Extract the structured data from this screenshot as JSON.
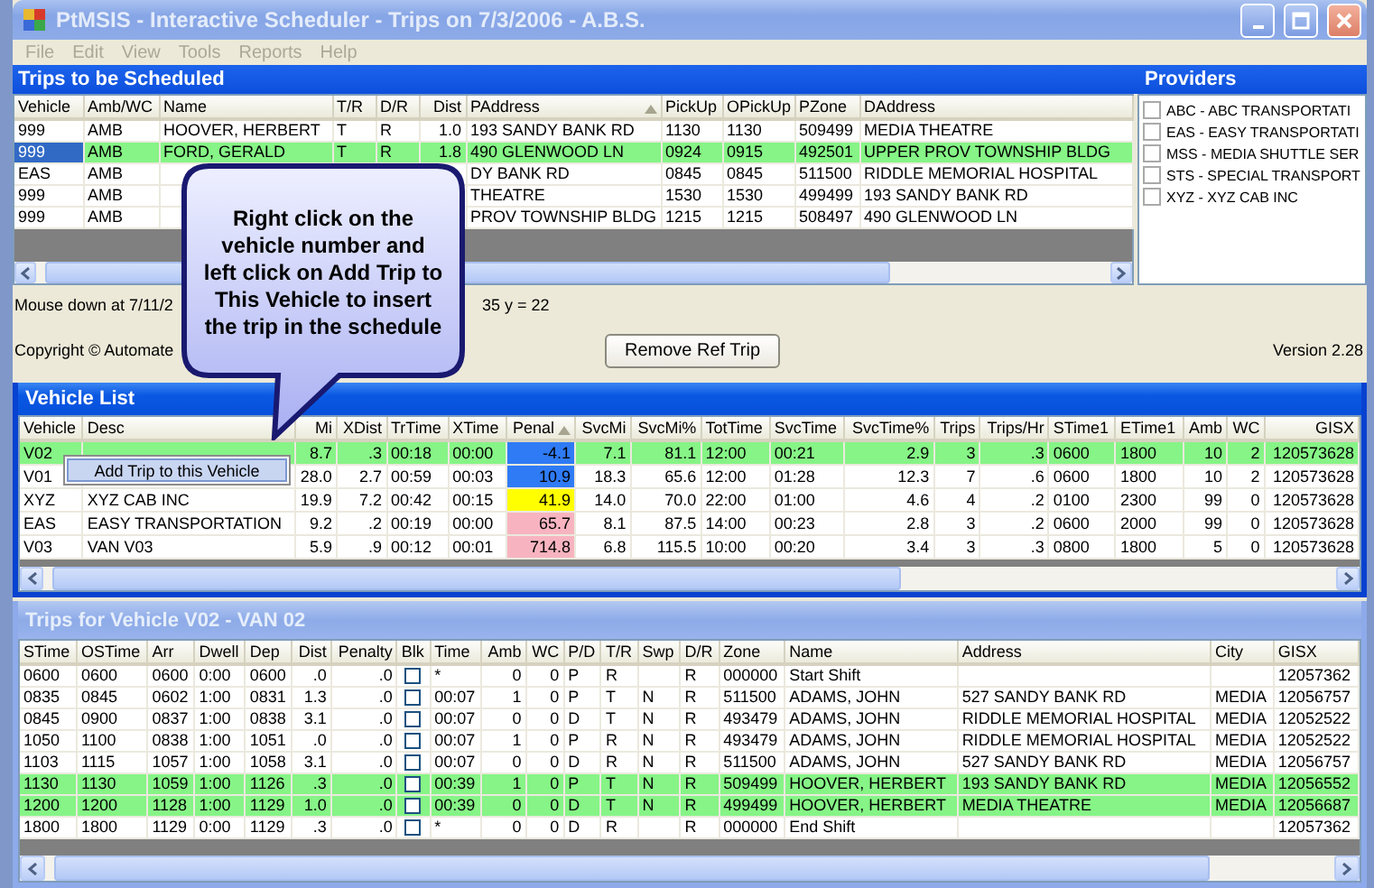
{
  "window": {
    "title": "PtMSIS - Interactive Scheduler - Trips on 7/3/2006 - A.B.S.",
    "active": false
  },
  "menu": [
    {
      "label": "File",
      "disabled": true
    },
    {
      "label": "Edit",
      "disabled": true
    },
    {
      "label": "View",
      "disabled": true
    },
    {
      "label": "Tools",
      "disabled": true
    },
    {
      "label": "Reports",
      "disabled": true
    },
    {
      "label": "Help",
      "disabled": true
    }
  ],
  "trips_to_schedule": {
    "title": "Trips to be Scheduled",
    "columns": [
      {
        "label": "Vehicle",
        "kind": "text",
        "sorted": false
      },
      {
        "label": "Amb/WC",
        "kind": "text",
        "sorted": false
      },
      {
        "label": "Name",
        "kind": "text",
        "sorted": false
      },
      {
        "label": "T/R",
        "kind": "text",
        "sorted": false
      },
      {
        "label": "D/R",
        "kind": "text",
        "sorted": false
      },
      {
        "label": "Dist",
        "kind": "num",
        "sorted": false
      },
      {
        "label": "PAddress",
        "kind": "text",
        "sorted": true
      },
      {
        "label": "PickUp",
        "kind": "text",
        "sorted": false
      },
      {
        "label": "OPickUp",
        "kind": "text",
        "sorted": false
      },
      {
        "label": "PZone",
        "kind": "text",
        "sorted": false
      },
      {
        "label": "DAddress",
        "kind": "text",
        "sorted": false
      }
    ],
    "rows": [
      {
        "selected": false,
        "focused": false,
        "cells": [
          "999",
          "AMB",
          "HOOVER, HERBERT",
          "T",
          "R",
          "1.0",
          "193 SANDY BANK RD",
          "1130",
          "1130",
          "509499",
          "MEDIA THEATRE"
        ]
      },
      {
        "selected": true,
        "focused": true,
        "cells": [
          "999",
          "AMB",
          "FORD, GERALD",
          "T",
          "R",
          "1.8",
          "490 GLENWOOD LN",
          "0924",
          "0915",
          "492501",
          "UPPER PROV TOWNSHIP BLDG"
        ]
      },
      {
        "selected": false,
        "focused": false,
        "cells": [
          "EAS",
          "AMB",
          null,
          null,
          null,
          null,
          "DY BANK RD",
          "0845",
          "0845",
          "511500",
          "RIDDLE MEMORIAL HOSPITAL"
        ]
      },
      {
        "selected": false,
        "focused": false,
        "cells": [
          "999",
          "AMB",
          null,
          null,
          null,
          null,
          "THEATRE",
          "1530",
          "1530",
          "499499",
          "193 SANDY BANK RD"
        ]
      },
      {
        "selected": false,
        "focused": false,
        "cells": [
          "999",
          "AMB",
          null,
          null,
          null,
          null,
          "PROV TOWNSHIP BLDG",
          "1215",
          "1215",
          "508497",
          "490 GLENWOOD LN"
        ]
      }
    ]
  },
  "providers": {
    "title": "Providers",
    "items": [
      {
        "label": "ABC - ABC TRANSPORTATI",
        "checked": false
      },
      {
        "label": "EAS - EASY TRANSPORTATI",
        "checked": false
      },
      {
        "label": "MSS - MEDIA SHUTTLE SER",
        "checked": false
      },
      {
        "label": "STS - SPECIAL TRANSPORT",
        "checked": false
      },
      {
        "label": "XYZ - XYZ CAB INC",
        "checked": false
      }
    ]
  },
  "status": {
    "mouse_text": "Mouse down at 7/11/2",
    "mouse_coords": "35 y = 22",
    "copyright": "Copyright © Automate",
    "button": "Remove Ref Trip",
    "version": "Version 2.28"
  },
  "vehicle_list": {
    "title": "Vehicle List",
    "active": true,
    "columns": [
      {
        "label": "Vehicle",
        "kind": "text",
        "sorted": false
      },
      {
        "label": "Desc",
        "kind": "text",
        "sorted": false
      },
      {
        "label": "Mi",
        "kind": "num",
        "sorted": false
      },
      {
        "label": "XDist",
        "kind": "num",
        "sorted": false
      },
      {
        "label": "TrTime",
        "kind": "text",
        "sorted": false
      },
      {
        "label": "XTime",
        "kind": "text",
        "sorted": false
      },
      {
        "label": "Penal",
        "kind": "num",
        "sorted": true
      },
      {
        "label": "SvcMi",
        "kind": "num",
        "sorted": false
      },
      {
        "label": "SvcMi%",
        "kind": "num",
        "sorted": false
      },
      {
        "label": "TotTime",
        "kind": "text",
        "sorted": false
      },
      {
        "label": "SvcTime",
        "kind": "text",
        "sorted": false
      },
      {
        "label": "SvcTime%",
        "kind": "num",
        "sorted": false
      },
      {
        "label": "Trips",
        "kind": "num",
        "sorted": false
      },
      {
        "label": "Trips/Hr",
        "kind": "num",
        "sorted": false
      },
      {
        "label": "STime1",
        "kind": "text",
        "sorted": false
      },
      {
        "label": "ETime1",
        "kind": "text",
        "sorted": false
      },
      {
        "label": "Amb",
        "kind": "num",
        "sorted": false
      },
      {
        "label": "WC",
        "kind": "num",
        "sorted": false
      },
      {
        "label": "GISX",
        "kind": "num",
        "sorted": false
      }
    ],
    "rows": [
      {
        "selected": true,
        "cells": [
          "V02",
          null,
          "8.7",
          ".3",
          "00:18",
          "00:00",
          {
            "text": "-4.1",
            "color": "#2f7bf5"
          },
          "7.1",
          "81.1",
          "12:00",
          "00:21",
          "2.9",
          "3",
          ".3",
          "0600",
          "1800",
          "10",
          "2",
          "120573628"
        ]
      },
      {
        "selected": false,
        "cells": [
          "V01",
          null,
          "28.0",
          "2.7",
          "00:59",
          "00:03",
          {
            "text": "10.9",
            "color": "#2f7bf5"
          },
          "18.3",
          "65.6",
          "12:00",
          "01:28",
          "12.3",
          "7",
          ".6",
          "0600",
          "1800",
          "10",
          "2",
          "120573628"
        ]
      },
      {
        "selected": false,
        "cells": [
          "XYZ",
          "XYZ CAB INC",
          "19.9",
          "7.2",
          "00:42",
          "00:15",
          {
            "text": "41.9",
            "color": "#ffff00"
          },
          "14.0",
          "70.0",
          "22:00",
          "01:00",
          "4.6",
          "4",
          ".2",
          "0100",
          "2300",
          "99",
          "0",
          "120573628"
        ]
      },
      {
        "selected": false,
        "cells": [
          "EAS",
          "EASY TRANSPORTATION",
          "9.2",
          ".2",
          "00:19",
          "00:00",
          {
            "text": "65.7",
            "color": "#f7b4c0"
          },
          "8.1",
          "87.5",
          "14:00",
          "00:23",
          "2.8",
          "3",
          ".2",
          "0600",
          "2000",
          "99",
          "0",
          "120573628"
        ]
      },
      {
        "selected": false,
        "cells": [
          "V03",
          "VAN V03",
          "5.9",
          ".9",
          "00:12",
          "00:01",
          {
            "text": "714.8",
            "color": "#f7b4c0"
          },
          "6.8",
          "115.5",
          "10:00",
          "00:20",
          "3.4",
          "3",
          ".3",
          "0800",
          "1800",
          "5",
          "0",
          "120573628"
        ]
      }
    ]
  },
  "vehicle_trips": {
    "title": "Trips for Vehicle V02 - VAN 02",
    "active": false,
    "columns": [
      {
        "label": "STime",
        "kind": "text",
        "sorted": false
      },
      {
        "label": "OSTime",
        "kind": "text",
        "sorted": false
      },
      {
        "label": "Arr",
        "kind": "text",
        "sorted": false
      },
      {
        "label": "Dwell",
        "kind": "text",
        "sorted": false
      },
      {
        "label": "Dep",
        "kind": "text",
        "sorted": false
      },
      {
        "label": "Dist",
        "kind": "num",
        "sorted": false
      },
      {
        "label": "Penalty",
        "kind": "num",
        "sorted": false
      },
      {
        "label": "Blk",
        "kind": "check",
        "sorted": false
      },
      {
        "label": "Time",
        "kind": "text",
        "sorted": false
      },
      {
        "label": "Amb",
        "kind": "num",
        "sorted": false
      },
      {
        "label": "WC",
        "kind": "num",
        "sorted": false
      },
      {
        "label": "P/D",
        "kind": "text",
        "sorted": false
      },
      {
        "label": "T/R",
        "kind": "text",
        "sorted": false
      },
      {
        "label": "Swp",
        "kind": "text",
        "sorted": false
      },
      {
        "label": "D/R",
        "kind": "text",
        "sorted": false
      },
      {
        "label": "Zone",
        "kind": "text",
        "sorted": false
      },
      {
        "label": "Name",
        "kind": "text",
        "sorted": false
      },
      {
        "label": "Address",
        "kind": "text",
        "sorted": false
      },
      {
        "label": "City",
        "kind": "text",
        "sorted": false
      },
      {
        "label": "GISX",
        "kind": "text",
        "sorted": false
      }
    ],
    "rows": [
      {
        "selected": false,
        "cells": [
          "0600",
          "0600",
          "0600",
          "0:00",
          "0600",
          ".0",
          ".0",
          {
            "checked": false
          },
          "*",
          "0",
          "0",
          "P",
          "R",
          null,
          "R",
          "000000",
          "Start Shift",
          null,
          null,
          "12057362"
        ]
      },
      {
        "selected": false,
        "cells": [
          "0835",
          "0845",
          "0602",
          "1:00",
          "0831",
          "1.3",
          ".0",
          {
            "checked": false
          },
          "00:07",
          "1",
          "0",
          "P",
          "T",
          "N",
          "R",
          "511500",
          "ADAMS, JOHN",
          "527 SANDY BANK RD",
          "MEDIA",
          "12056757"
        ]
      },
      {
        "selected": false,
        "cells": [
          "0845",
          "0900",
          "0837",
          "1:00",
          "0838",
          "3.1",
          ".0",
          {
            "checked": false
          },
          "00:07",
          "0",
          "0",
          "D",
          "T",
          "N",
          "R",
          "493479",
          "ADAMS, JOHN",
          "RIDDLE MEMORIAL HOSPITAL",
          "MEDIA",
          "12052522"
        ]
      },
      {
        "selected": false,
        "cells": [
          "1050",
          "1100",
          "0838",
          "1:00",
          "1051",
          ".0",
          ".0",
          {
            "checked": false
          },
          "00:07",
          "1",
          "0",
          "P",
          "R",
          "N",
          "R",
          "493479",
          "ADAMS, JOHN",
          "RIDDLE MEMORIAL HOSPITAL",
          "MEDIA",
          "12052522"
        ]
      },
      {
        "selected": false,
        "cells": [
          "1103",
          "1115",
          "1057",
          "1:00",
          "1058",
          "3.1",
          ".0",
          {
            "checked": false
          },
          "00:07",
          "0",
          "0",
          "D",
          "R",
          "N",
          "R",
          "511500",
          "ADAMS, JOHN",
          "527 SANDY BANK RD",
          "MEDIA",
          "12056757"
        ]
      },
      {
        "selected": true,
        "cells": [
          "1130",
          "1130",
          "1059",
          "1:00",
          "1126",
          ".3",
          ".0",
          {
            "checked": false
          },
          "00:39",
          "1",
          "0",
          "P",
          "T",
          "N",
          "R",
          "509499",
          "HOOVER, HERBERT",
          "193 SANDY BANK RD",
          "MEDIA",
          "12056552"
        ]
      },
      {
        "selected": true,
        "cells": [
          "1200",
          "1200",
          "1128",
          "1:00",
          "1129",
          "1.0",
          ".0",
          {
            "checked": false
          },
          "00:39",
          "0",
          "0",
          "D",
          "T",
          "N",
          "R",
          "499499",
          "HOOVER, HERBERT",
          "MEDIA THEATRE",
          "MEDIA",
          "12056687"
        ]
      },
      {
        "selected": false,
        "cells": [
          "1800",
          "1800",
          "1129",
          "0:00",
          "1129",
          ".3",
          ".0",
          {
            "checked": false
          },
          "*",
          "0",
          "0",
          "D",
          "R",
          null,
          "R",
          "000000",
          "End Shift",
          null,
          null,
          "12057362"
        ]
      }
    ]
  },
  "callout": {
    "text": "Right click on the\nvehicle number and\nleft click on Add Trip to\nThis Vehicle to insert\nthe trip in the schedule"
  },
  "context_menu": {
    "items": [
      {
        "label": "Add Trip to this Vehicle",
        "selected": true
      }
    ]
  }
}
